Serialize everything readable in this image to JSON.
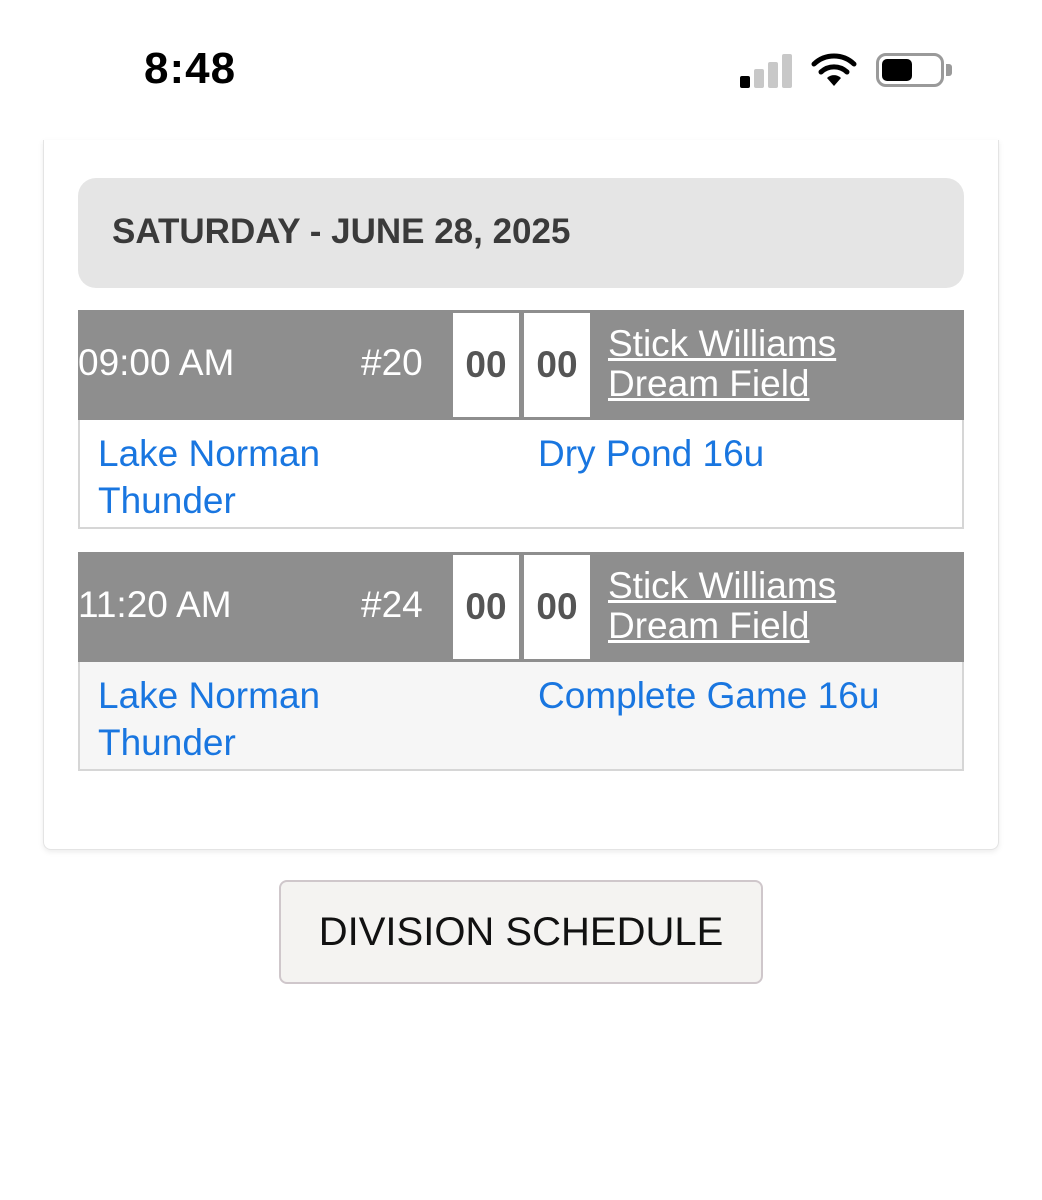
{
  "status_bar": {
    "time": "8:48"
  },
  "schedule": {
    "day_header": "SATURDAY - JUNE 28, 2025",
    "games": [
      {
        "time": "09:00 AM",
        "game_number": "#20",
        "home_score": "00",
        "away_score": "00",
        "field_line1": "Stick Williams",
        "field_line2": "Dream Field",
        "home_team": "Lake Norman Thunder",
        "away_team": "Dry Pond 16u"
      },
      {
        "time": "11:20 AM",
        "game_number": "#24",
        "home_score": "00",
        "away_score": "00",
        "field_line1": "Stick Williams",
        "field_line2": "Dream Field",
        "home_team": "Lake Norman Thunder",
        "away_team": "Complete Game 16u"
      }
    ]
  },
  "division_button": {
    "label": "DIVISION SCHEDULE"
  },
  "colors": {
    "header_bg": "#e5e5e5",
    "game_bar_bg": "#8e8e8e",
    "team_link": "#1976e0"
  }
}
